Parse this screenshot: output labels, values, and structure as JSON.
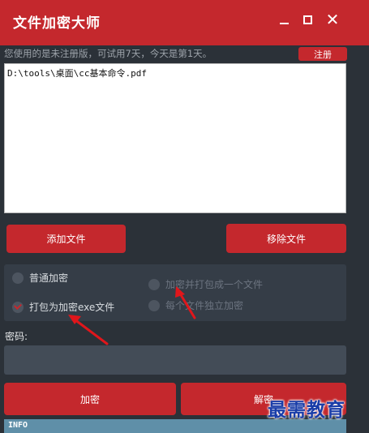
{
  "window": {
    "title": "文件加密大师",
    "minimize_icon": "minimize-icon",
    "maximize_icon": "maximize-icon",
    "close_icon": "close-icon",
    "close_glyph": "✕"
  },
  "notice": {
    "text": "您使用的是未注册版，可试用7天，今天是第1天。",
    "register_label": "注册"
  },
  "file_list": {
    "items": [
      "D:\\tools\\桌面\\cc基本命令.pdf"
    ]
  },
  "actions": {
    "add_label": "添加文件",
    "remove_label": "移除文件"
  },
  "options": {
    "normal_label": "普通加密",
    "pack_exe_label": "打包为加密exe文件",
    "pack_one_label": "加密并打包成一个文件",
    "each_label": "每个文件独立加密",
    "selected": "打包为加密exe文件"
  },
  "password": {
    "label": "密码:",
    "value": ""
  },
  "buttons": {
    "encrypt_label": "加密",
    "decrypt_label": "解密"
  },
  "info": {
    "label": "INFO"
  },
  "watermark": {
    "text": "最需教育"
  },
  "colors": {
    "accent": "#c4282d",
    "background": "#2b3138",
    "annotation_arrow": "#e0161b",
    "watermark": "#1a3da8"
  }
}
